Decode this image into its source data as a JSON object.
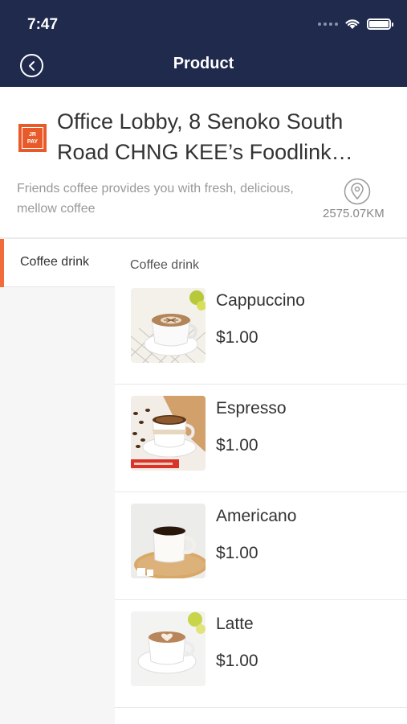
{
  "status_bar": {
    "time": "7:47"
  },
  "nav": {
    "title": "Product"
  },
  "store": {
    "logo_text_line1": "JR",
    "logo_text_line2": "PAY",
    "name": "Office Lobby, 8 Senoko South Road CHNG KEE’s Foodlink…",
    "description": "Friends coffee provides you with fresh, delicious, mellow coffee",
    "distance": "2575.07KM"
  },
  "sidebar": {
    "items": [
      {
        "label": "Coffee drink"
      }
    ]
  },
  "category": {
    "title": "Coffee drink"
  },
  "products": [
    {
      "name": "Cappuccino",
      "price": "$1.00"
    },
    {
      "name": "Espresso",
      "price": "$1.00"
    },
    {
      "name": "Americano",
      "price": "$1.00"
    },
    {
      "name": "Latte",
      "price": "$1.00"
    }
  ],
  "colors": {
    "header_bg": "#1f2a4d",
    "accent": "#f26b3a",
    "logo_bg": "#e85a2a"
  }
}
